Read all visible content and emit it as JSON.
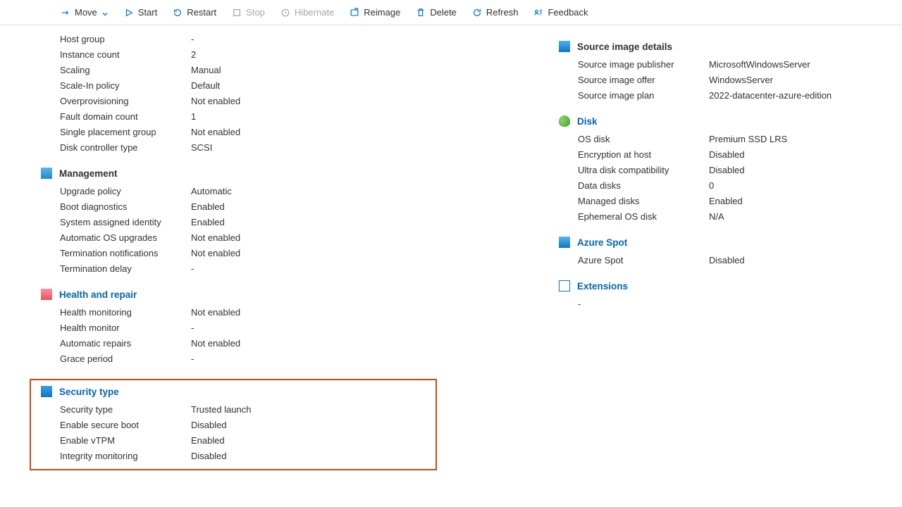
{
  "toolbar": {
    "move": "Move",
    "start": "Start",
    "restart": "Restart",
    "stop": "Stop",
    "hibernate": "Hibernate",
    "reimage": "Reimage",
    "delete": "Delete",
    "refresh": "Refresh",
    "feedback": "Feedback"
  },
  "left": {
    "top_rows": [
      {
        "label": "Host group",
        "value": "-"
      },
      {
        "label": "Instance count",
        "value": "2"
      },
      {
        "label": "Scaling",
        "value": "Manual"
      },
      {
        "label": "Scale-In policy",
        "value": "Default"
      },
      {
        "label": "Overprovisioning",
        "value": "Not enabled"
      },
      {
        "label": "Fault domain count",
        "value": "1"
      },
      {
        "label": "Single placement group",
        "value": "Not enabled"
      },
      {
        "label": "Disk controller type",
        "value": "SCSI"
      }
    ],
    "management": {
      "title": "Management",
      "rows": [
        {
          "label": "Upgrade policy",
          "value": "Automatic"
        },
        {
          "label": "Boot diagnostics",
          "value": "Enabled"
        },
        {
          "label": "System assigned identity",
          "value": "Enabled"
        },
        {
          "label": "Automatic OS upgrades",
          "value": "Not enabled"
        },
        {
          "label": "Termination notifications",
          "value": "Not enabled"
        },
        {
          "label": "Termination delay",
          "value": "-"
        }
      ]
    },
    "health": {
      "title": "Health and repair",
      "rows": [
        {
          "label": "Health monitoring",
          "value": "Not enabled"
        },
        {
          "label": "Health monitor",
          "value": "-"
        },
        {
          "label": "Automatic repairs",
          "value": "Not enabled"
        },
        {
          "label": "Grace period",
          "value": "-"
        }
      ]
    },
    "security": {
      "title": "Security type",
      "rows": [
        {
          "label": "Security type",
          "value": "Trusted launch"
        },
        {
          "label": "Enable secure boot",
          "value": "Disabled"
        },
        {
          "label": "Enable vTPM",
          "value": "Enabled"
        },
        {
          "label": "Integrity monitoring",
          "value": "Disabled"
        }
      ]
    }
  },
  "right": {
    "image": {
      "title": "Source image details",
      "rows": [
        {
          "label": "Source image publisher",
          "value": "MicrosoftWindowsServer"
        },
        {
          "label": "Source image offer",
          "value": "WindowsServer"
        },
        {
          "label": "Source image plan",
          "value": "2022-datacenter-azure-edition"
        }
      ]
    },
    "disk": {
      "title": "Disk",
      "rows": [
        {
          "label": "OS disk",
          "value": "Premium SSD LRS"
        },
        {
          "label": "Encryption at host",
          "value": "Disabled"
        },
        {
          "label": "Ultra disk compatibility",
          "value": "Disabled"
        },
        {
          "label": "Data disks",
          "value": "0"
        },
        {
          "label": "Managed disks",
          "value": "Enabled"
        },
        {
          "label": "Ephemeral OS disk",
          "value": "N/A"
        }
      ]
    },
    "spot": {
      "title": "Azure Spot",
      "rows": [
        {
          "label": "Azure Spot",
          "value": "Disabled"
        }
      ]
    },
    "extensions": {
      "title": "Extensions",
      "value": "-"
    }
  }
}
